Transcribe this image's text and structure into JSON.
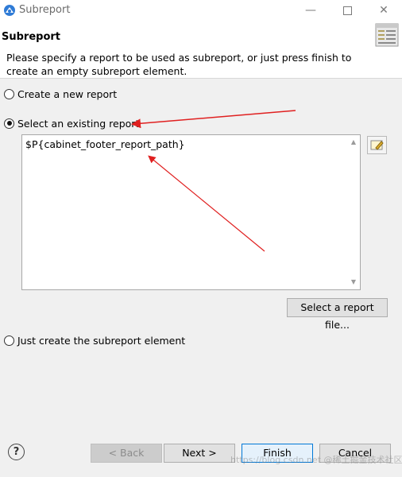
{
  "window": {
    "title": "Subreport",
    "controls": {
      "minimize": "—",
      "close": "✕"
    }
  },
  "header": {
    "title": "Subreport",
    "description": "Please specify a report to be used as subreport, or just press finish to create an empty subreport element.",
    "icon": "wizard-page-icon"
  },
  "options": {
    "create_new": "Create a new report",
    "select_existing": "Select an existing report",
    "just_create": "Just create the subreport element",
    "selected": "select_existing"
  },
  "expression": {
    "value": "$P{cabinet_footer_report_path}"
  },
  "buttons": {
    "select_file": "Select a report file...",
    "back": "< Back",
    "next": "Next >",
    "finish": "Finish",
    "cancel": "Cancel",
    "help": "?"
  },
  "annotations": {
    "arrow_color": "#e02020"
  },
  "watermark": "https://blog.csdn.net @稀土掘金技术社区"
}
